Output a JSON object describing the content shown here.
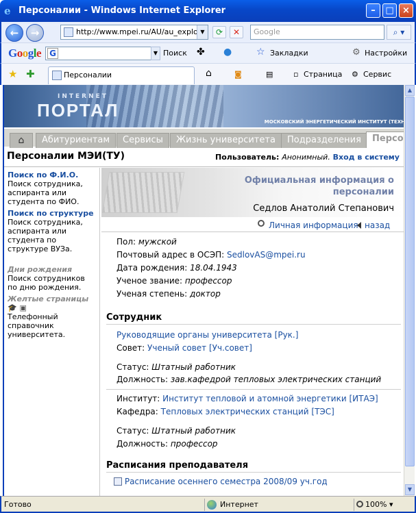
{
  "window": {
    "title": "Персоналии - Windows Internet Explorer"
  },
  "navbar": {
    "url": "http://www.mpei.ru/AU/au_explorer",
    "search_placeholder": "Google"
  },
  "gbar": {
    "search_label": "Поиск",
    "bookmarks_label": "Закладки",
    "settings_label": "Настройки"
  },
  "favbar": {
    "tab_title": "Персоналии",
    "page_label": "Страница",
    "service_label": "Сервис"
  },
  "banner": {
    "kicker": "INTERNET",
    "logo": "ПОРТАЛ",
    "institute": "МОСКОВСКИЙ ЭНЕРГЕТИЧЕСКИЙ ИНСТИТУТ (ТЕХН"
  },
  "tabs": [
    "Абитуриентам",
    "Сервисы",
    "Жизнь университета",
    "Подразделения",
    "Персона"
  ],
  "header": {
    "title": "Персоналии МЭИ(ТУ)",
    "user_label": "Пользователь:",
    "user_value": "Анонимный.",
    "login": "Вход в систему"
  },
  "sidebar": {
    "items": [
      {
        "title": "Поиск по Ф.И.О.",
        "desc": "Поиск сотрудника, аспиранта или студента по ФИО."
      },
      {
        "title": "Поиск по структуре",
        "desc": "Поиск сотрудника, аспиранта или студента по структуре ВУЗа."
      },
      {
        "title": "Дни рождения",
        "desc": "Поиск сотрудников по дню рождения."
      },
      {
        "title": "Желтые страницы",
        "desc": "Телефонный справочник университета."
      }
    ]
  },
  "profile": {
    "official_heading": "Официальная информация о персоналии",
    "name": "Седлов Анатолий Степанович",
    "personal_link": "Личная информация",
    "back_link": "назад",
    "gender_label": "Пол:",
    "gender": "мужской",
    "email_label": "Почтовый адрес в ОСЭП:",
    "email": "SedlovAS@mpei.ru",
    "birth_label": "Дата рождения:",
    "birth": "18.04.1943",
    "title_label": "Ученое звание:",
    "title": "профессор",
    "degree_label": "Ученая степень:",
    "degree": "доктор"
  },
  "employee": {
    "heading": "Сотрудник",
    "org": "Руководящие органы университета [Рук.]",
    "council_label": "Совет:",
    "council": "Ученый совет [Уч.совет]",
    "status1_label": "Статус:",
    "status1": "Штатный работник",
    "pos1_label": "Должность:",
    "pos1": "зав.кафедрой тепловых электрических станций",
    "institute_label": "Институт:",
    "institute": "Институт тепловой и атомной энергетики [ИТАЭ]",
    "dept_label": "Кафедра:",
    "dept": "Тепловых электрических станций [ТЭС]",
    "status2_label": "Статус:",
    "status2": "Штатный работник",
    "pos2_label": "Должность:",
    "pos2": "профессор"
  },
  "schedule": {
    "heading": "Расписания преподавателя",
    "link": "Расписание осеннего семестра 2008/09 уч.год"
  },
  "status": {
    "ready": "Готово",
    "zone": "Интернет",
    "zoom": "100%"
  }
}
